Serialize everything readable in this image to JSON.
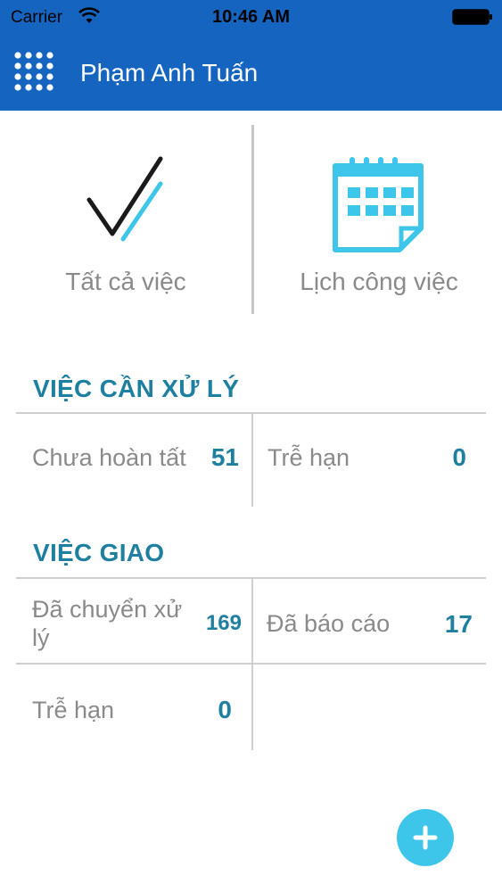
{
  "status_bar": {
    "carrier": "Carrier",
    "time": "10:46 AM"
  },
  "nav": {
    "title": "Phạm Anh Tuấn",
    "background_color": "#1565c0"
  },
  "shortcuts": [
    {
      "label": "Tất cả việc",
      "icon": "checkmark-icon"
    },
    {
      "label": "Lịch công việc",
      "icon": "calendar-icon"
    }
  ],
  "pending_section": {
    "title": "VIỆC CẦN XỬ LÝ",
    "cells": [
      {
        "label": "Chưa hoàn tất",
        "value": "51"
      },
      {
        "label": "Trễ hạn",
        "value": "0"
      }
    ]
  },
  "assigned_section": {
    "title": "VIỆC GIAO",
    "cells": [
      {
        "label": "Đã chuyển xử lý",
        "value": "169"
      },
      {
        "label": "Đã báo cáo",
        "value": "17"
      },
      {
        "label": "Trễ hạn",
        "value": "0"
      }
    ]
  },
  "fab": {
    "icon": "plus-icon"
  },
  "colors": {
    "accent": "#1f7fa0",
    "icon_blue": "#3ec6ea",
    "label_gray": "#8a8a8a"
  }
}
